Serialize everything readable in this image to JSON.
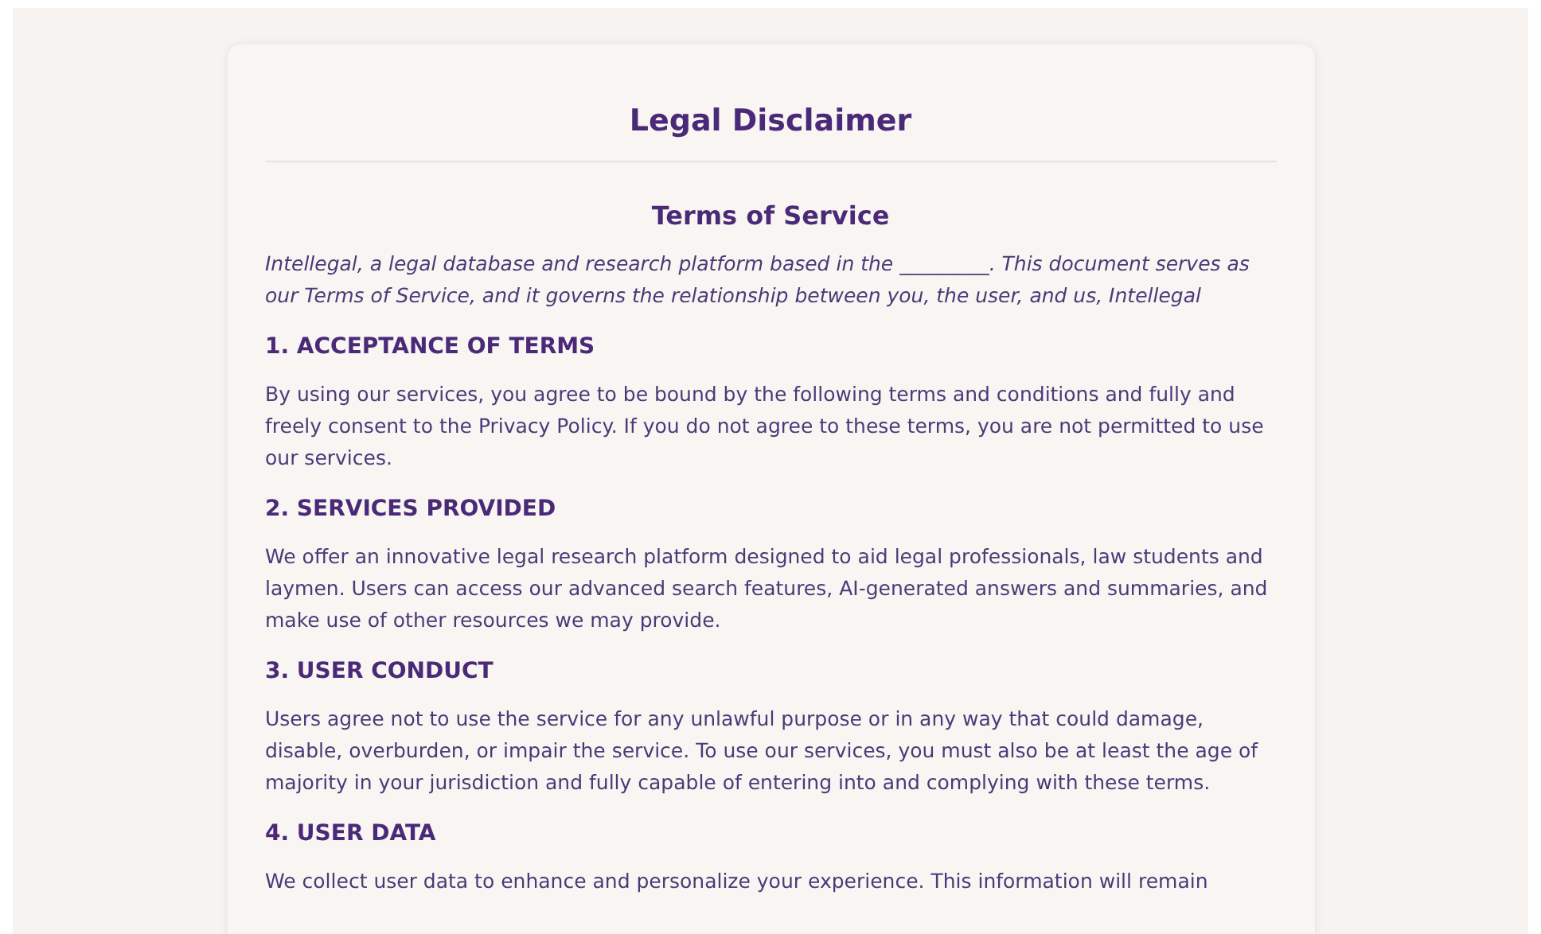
{
  "title": "Legal Disclaimer",
  "subtitle": "Terms of Service",
  "intro": "Intellegal, a legal database and research platform based in the _________. This document serves as our Terms of Service, and it governs the relationship between you, the user, and us, Intellegal",
  "sections": [
    {
      "heading": "1. ACCEPTANCE OF TERMS",
      "body": "By using our services, you agree to be bound by the following terms and conditions and fully and freely consent to the Privacy Policy. If you do not agree to these terms, you are not permitted to use our services."
    },
    {
      "heading": "2. SERVICES PROVIDED",
      "body": "We offer an innovative legal research platform designed to aid legal professionals, law students and laymen. Users can access our advanced search features, AI-generated answers and summaries, and make use of other resources we may provide."
    },
    {
      "heading": "3. USER CONDUCT",
      "body": "Users agree not to use the service for any unlawful purpose or in any way that could damage, disable, overburden, or impair the service. To use our services, you must also be at least the age of majority in your jurisdiction and fully capable of entering into and complying with these terms."
    },
    {
      "heading": "4. USER DATA",
      "body": "We collect user data to enhance and personalize your experience. This information will remain"
    }
  ]
}
